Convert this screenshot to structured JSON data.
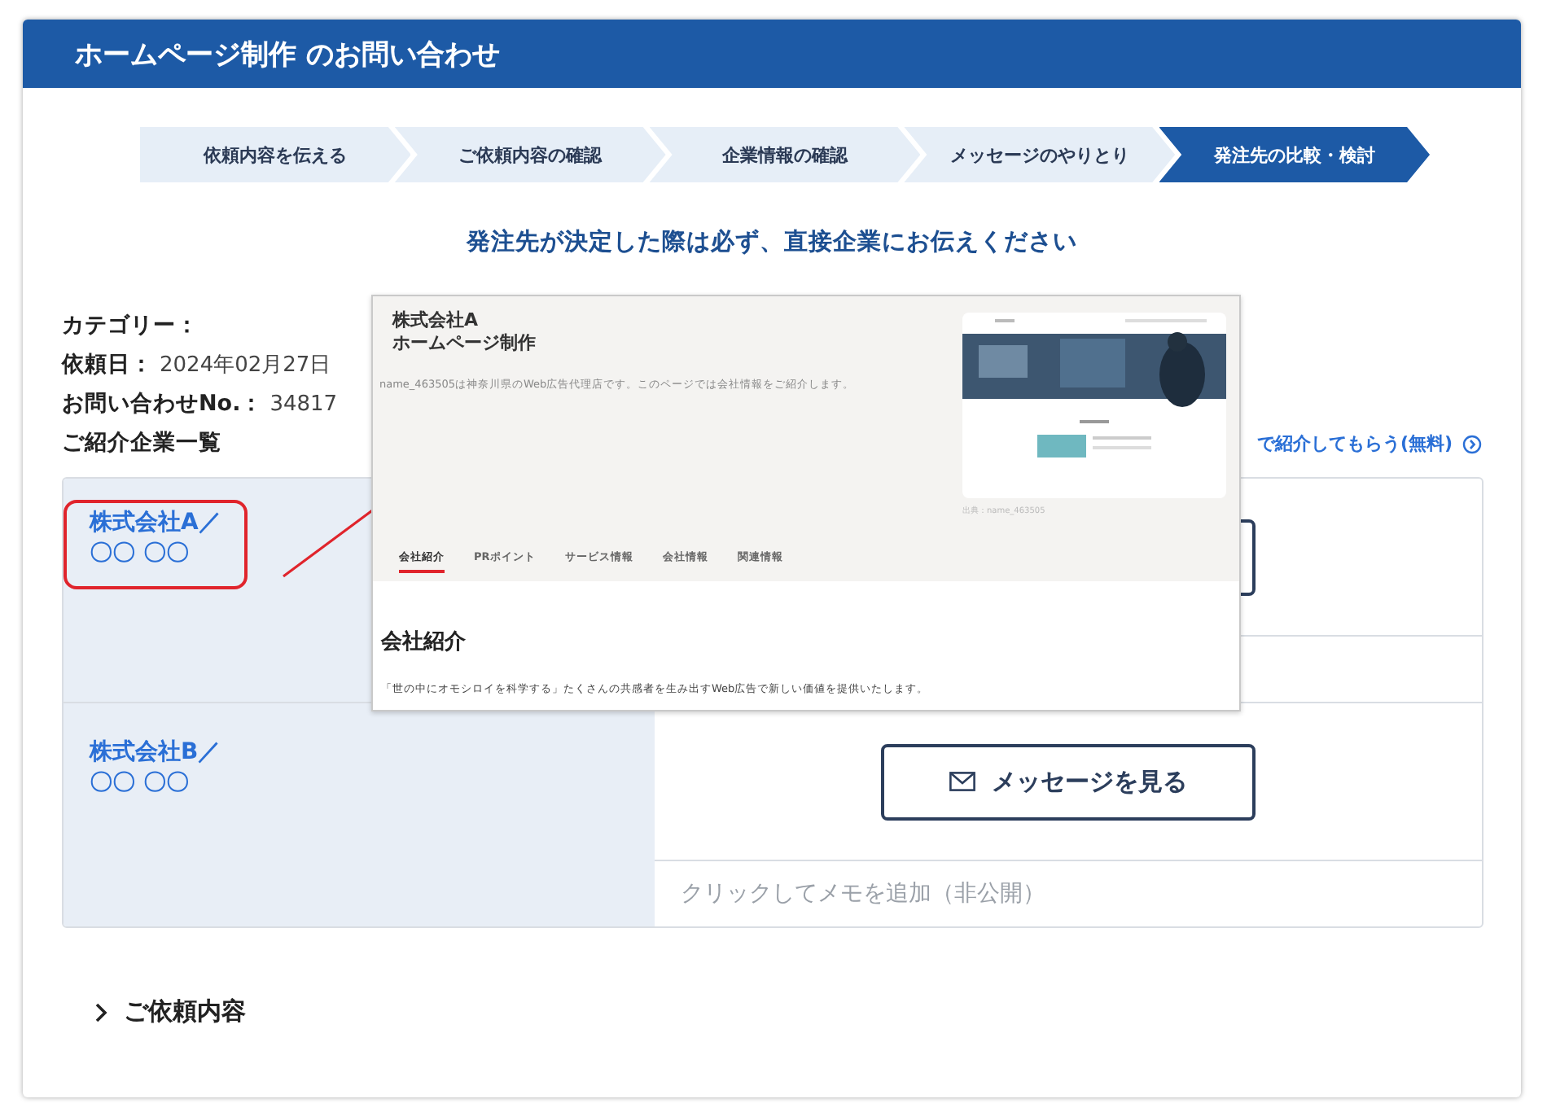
{
  "header": {
    "title": "ホームページ制作 のお問い合わせ"
  },
  "steps": [
    {
      "label": "依頼内容を伝える",
      "selected": false
    },
    {
      "label": "ご依頼内容の確認",
      "selected": false
    },
    {
      "label": "企業情報の確認",
      "selected": false
    },
    {
      "label": "メッセージのやりとり",
      "selected": false
    },
    {
      "label": "発注先の比較・検討",
      "selected": true
    }
  ],
  "notice": "発注先が決定した際は必ず、直接企業にお伝えください",
  "info": [
    {
      "label": "カテゴリー："
    },
    {
      "label": "依頼日：",
      "value": "2024年02月27日"
    },
    {
      "label": "お問い合わせNo.：",
      "value": "34817"
    }
  ],
  "list_title": "ご紹介企業一覧",
  "referral_link": "で紹介してもらう(無料)",
  "companies": [
    {
      "name": "株式会社A／",
      "contact": "〇〇 〇〇",
      "highlighted": true
    },
    {
      "name": "株式会社B／",
      "contact": "〇〇 〇〇",
      "highlighted": false,
      "button": "メッセージを見る",
      "memo_placeholder": "クリックしてメモを追加（非公開）"
    }
  ],
  "popup": {
    "company": "株式会社A",
    "service": "ホームページ制作",
    "description": "name_463505は神奈川県のWeb広告代理店です。このページでは会社情報をご紹介します。",
    "image_caption": "出典：name_463505",
    "tabs": [
      {
        "label": "会社紹介",
        "selected": true
      },
      {
        "label": "PRポイント",
        "selected": false
      },
      {
        "label": "サービス情報",
        "selected": false
      },
      {
        "label": "会社情報",
        "selected": false
      },
      {
        "label": "関連情報",
        "selected": false
      }
    ],
    "section_title": "会社紹介",
    "section_text": "「世の中にオモシロイを科学する」たくさんの共感者を生み出すWeb広告で新しい価値を提供いたします。"
  },
  "details_toggle": {
    "label": "ご依頼内容",
    "expanded": false
  }
}
